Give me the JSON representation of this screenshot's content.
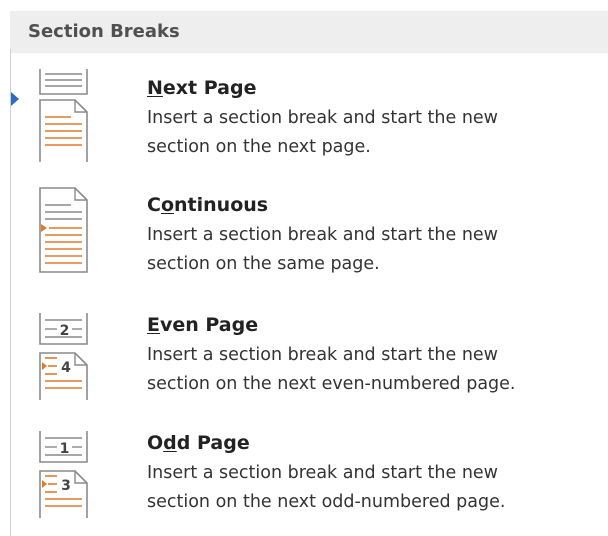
{
  "section_title": "Section Breaks",
  "items": [
    {
      "access_key": "N",
      "title_rest": "ext Page",
      "desc_line1": "Insert a section break and start the new",
      "desc_line2": "section on the next page.",
      "icon": "next-page-icon"
    },
    {
      "title_pre": "C",
      "access_key": "o",
      "title_rest": "ntinuous",
      "desc_line1": "Insert a section break and start the new",
      "desc_line2": "section on the same page.",
      "icon": "continuous-icon"
    },
    {
      "access_key": "E",
      "title_rest": "ven Page",
      "desc_line1": "Insert a section break and start the new",
      "desc_line2": "section on the next even-numbered page.",
      "icon": "even-page-icon",
      "num_top": "2",
      "num_bottom": "4"
    },
    {
      "title_pre": "O",
      "access_key": "d",
      "title_rest": "d Page",
      "desc_line1": "Insert a section break and start the new",
      "desc_line2": "section on the next odd-numbered page.",
      "icon": "odd-page-icon",
      "num_top": "1",
      "num_bottom": "3"
    }
  ],
  "colors": {
    "accent": "#2b6cc4",
    "orange": "#e07a2e",
    "gray": "#8a8a8a",
    "header_bg": "#eeeeee"
  }
}
